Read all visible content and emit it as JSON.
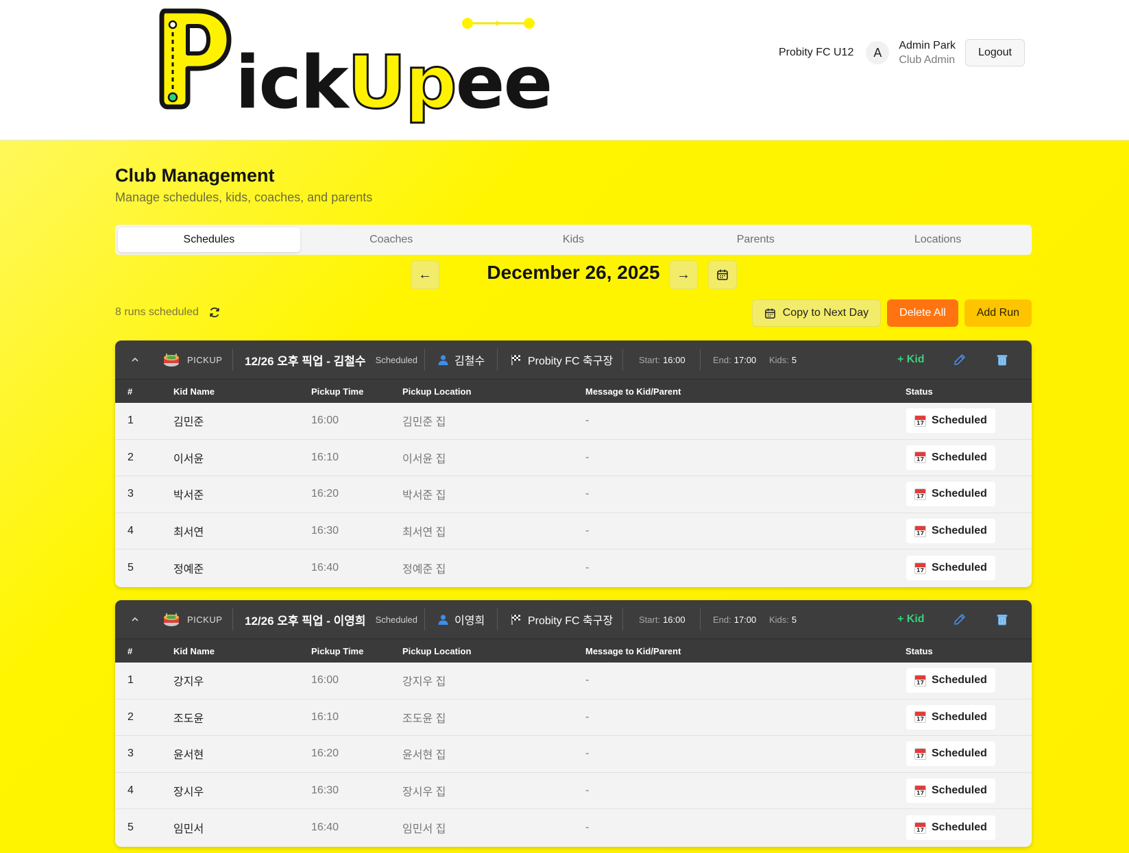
{
  "header": {
    "logo_text": {
      "p": "P",
      "ick": "ick",
      "up": "Up",
      "ee": "ee"
    },
    "club_name": "Probity FC U12",
    "avatar_initial": "A",
    "user_name": "Admin Park",
    "user_role": "Club Admin",
    "logout_label": "Logout"
  },
  "page": {
    "title": "Club Management",
    "subtitle": "Manage schedules, kids, coaches, and parents"
  },
  "tabs": [
    {
      "label": "Schedules",
      "active": true
    },
    {
      "label": "Coaches",
      "active": false
    },
    {
      "label": "Kids",
      "active": false
    },
    {
      "label": "Parents",
      "active": false
    },
    {
      "label": "Locations",
      "active": false
    }
  ],
  "date_nav": {
    "prev_label": "←",
    "next_label": "→",
    "date": "December 26, 2025"
  },
  "toolbar": {
    "runs_count": "8 runs scheduled",
    "copy_label": "Copy to Next Day",
    "delete_label": "Delete All",
    "add_label": "Add Run"
  },
  "table_headers": {
    "num": "#",
    "kid_name": "Kid Name",
    "pickup_time": "Pickup Time",
    "pickup_location": "Pickup Location",
    "message": "Message to Kid/Parent",
    "status": "Status"
  },
  "runs": [
    {
      "type": "PICKUP",
      "title": "12/26 오후 픽업 - 김철수",
      "status": "Scheduled",
      "coach": "김철수",
      "location": "Probity FC 축구장",
      "start_label": "Start:",
      "start": "16:00",
      "end_label": "End:",
      "end": "17:00",
      "kids_label": "Kids:",
      "kids": "5",
      "add_kid_label": "+ Kid",
      "rows": [
        {
          "num": "1",
          "kid": "김민준",
          "time": "16:00",
          "place": "김민준 집",
          "msg": "-",
          "status": "Scheduled"
        },
        {
          "num": "2",
          "kid": "이서윤",
          "time": "16:10",
          "place": "이서윤 집",
          "msg": "-",
          "status": "Scheduled"
        },
        {
          "num": "3",
          "kid": "박서준",
          "time": "16:20",
          "place": "박서준 집",
          "msg": "-",
          "status": "Scheduled"
        },
        {
          "num": "4",
          "kid": "최서연",
          "time": "16:30",
          "place": "최서연 집",
          "msg": "-",
          "status": "Scheduled"
        },
        {
          "num": "5",
          "kid": "정예준",
          "time": "16:40",
          "place": "정예준 집",
          "msg": "-",
          "status": "Scheduled"
        }
      ]
    },
    {
      "type": "PICKUP",
      "title": "12/26 오후 픽업 - 이영희",
      "status": "Scheduled",
      "coach": "이영희",
      "location": "Probity FC 축구장",
      "start_label": "Start:",
      "start": "16:00",
      "end_label": "End:",
      "end": "17:00",
      "kids_label": "Kids:",
      "kids": "5",
      "add_kid_label": "+ Kid",
      "rows": [
        {
          "num": "1",
          "kid": "강지우",
          "time": "16:00",
          "place": "강지우 집",
          "msg": "-",
          "status": "Scheduled"
        },
        {
          "num": "2",
          "kid": "조도윤",
          "time": "16:10",
          "place": "조도윤 집",
          "msg": "-",
          "status": "Scheduled"
        },
        {
          "num": "3",
          "kid": "윤서현",
          "time": "16:20",
          "place": "윤서현 집",
          "msg": "-",
          "status": "Scheduled"
        },
        {
          "num": "4",
          "kid": "장시우",
          "time": "16:30",
          "place": "장시우 집",
          "msg": "-",
          "status": "Scheduled"
        },
        {
          "num": "5",
          "kid": "임민서",
          "time": "16:40",
          "place": "임민서 집",
          "msg": "-",
          "status": "Scheduled"
        }
      ]
    }
  ]
}
